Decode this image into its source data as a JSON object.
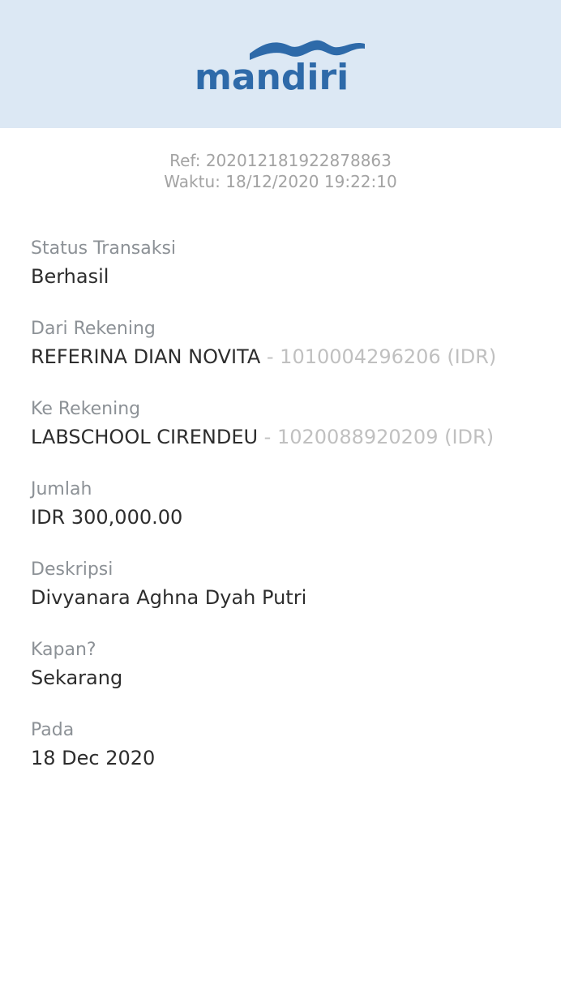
{
  "header": {
    "logo_text": "mandiri",
    "logo_color": "#2e6aa9",
    "background": "#dce8f4"
  },
  "meta": {
    "ref": "Ref: 202012181922878863",
    "time": "Waktu: 18/12/2020 19:22:10"
  },
  "fields": {
    "status": {
      "label": "Status Transaksi",
      "value": "Berhasil"
    },
    "from": {
      "label": "Dari Rekening",
      "name": "REFERINA DIAN NOVITA",
      "account": " - 1010004296206 (IDR)"
    },
    "to": {
      "label": "Ke Rekening",
      "name": "LABSCHOOL CIRENDEU",
      "account": " - 1020088920209 (IDR)"
    },
    "amount": {
      "label": "Jumlah",
      "value": "IDR 300,000.00"
    },
    "description": {
      "label": "Deskripsi",
      "value": "Divyanara Aghna Dyah Putri"
    },
    "when": {
      "label": "Kapan?",
      "value": "Sekarang"
    },
    "date": {
      "label": "Pada",
      "value": "18 Dec 2020"
    }
  }
}
